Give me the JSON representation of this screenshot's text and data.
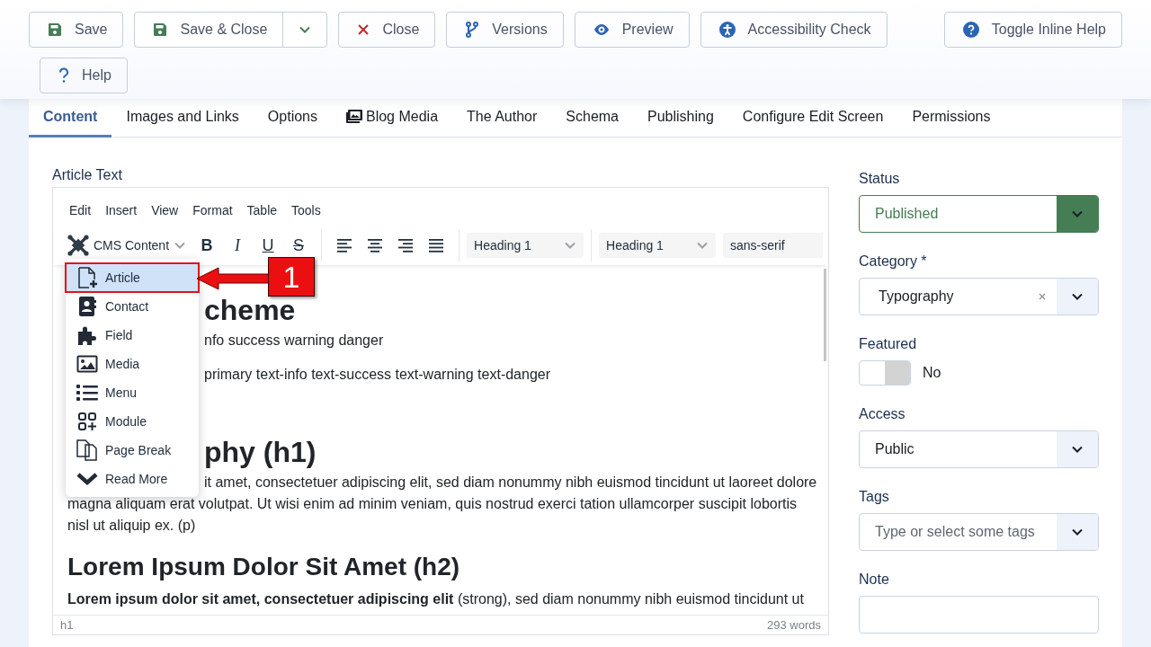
{
  "toolbar": {
    "buttons": [
      {
        "label": "Save",
        "dropdown": false
      },
      {
        "label": "Save & Close",
        "dropdown": true
      },
      {
        "label": "Close",
        "dropdown": false
      },
      {
        "label": "Versions",
        "dropdown": false
      },
      {
        "label": "Preview",
        "dropdown": false
      },
      {
        "label": "Accessibility Check",
        "dropdown": false
      }
    ],
    "right_buttons": [
      {
        "label": "Toggle Inline Help",
        "dropdown": false
      }
    ],
    "second_row": [
      {
        "label": "Help",
        "dropdown": false
      }
    ]
  },
  "tabs": [
    {
      "label": "Content",
      "selected": true
    },
    {
      "label": "Images and Links",
      "selected": false
    },
    {
      "label": "Options",
      "selected": false
    },
    {
      "label": "Blog Media",
      "selected": false
    },
    {
      "label": "The Author",
      "selected": false
    },
    {
      "label": "Schema",
      "selected": false
    },
    {
      "label": "Publishing",
      "selected": false
    },
    {
      "label": "Configure Edit Screen",
      "selected": false
    },
    {
      "label": "Permissions",
      "selected": false
    }
  ],
  "editor": {
    "label": "Article Text",
    "menubar": [
      "Edit",
      "Insert",
      "View",
      "Format",
      "Table",
      "Tools"
    ],
    "cms_content": "CMS Content",
    "format_buttons": [
      "B",
      "I",
      "U",
      "S"
    ],
    "selects": [
      "Heading 1",
      "Heading 1",
      "sans-serif"
    ],
    "dropdown": [
      {
        "label": "Article",
        "selected": true
      },
      {
        "label": "Contact",
        "selected": false
      },
      {
        "label": "Field",
        "selected": false
      },
      {
        "label": "Media",
        "selected": false
      },
      {
        "label": "Menu",
        "selected": false
      },
      {
        "label": "Module",
        "selected": false
      },
      {
        "label": "Page Break",
        "selected": false
      },
      {
        "label": "Read More",
        "selected": false
      }
    ],
    "content": [
      {
        "kind": "heading1",
        "text": "cheme"
      },
      {
        "kind": "paragraph",
        "text": "nfo success warning danger"
      },
      {
        "kind": "paragraph",
        "text": "primary text-info text-success text-warning text-danger"
      },
      {
        "kind": "heading1",
        "text": "phy (h1)"
      },
      {
        "kind": "paragraph",
        "text": "it amet, consectetuer adipiscing elit, sed diam nonummy nibh euismod tincidunt ut laoreet dolore"
      },
      {
        "kind": "continuation",
        "text": "magna aliquam erat volutpat. Ut wisi enim ad minim veniam, quis nostrud exerci tation ullamcorper suscipit lobortis nisl ut aliquip ex. (p)"
      },
      {
        "kind": "heading2",
        "text": "Lorem Ipsum Dolor Sit Amet (h2)"
      },
      {
        "kind": "paragraph",
        "text": "**Lorem ipsum dolor sit amet, consectetuer adipiscing elit** (strong), sed diam nonummy nibh euismod tincidunt ut"
      }
    ],
    "path": "h1",
    "word_count": "293 words",
    "callout": "1"
  },
  "sidebar": {
    "status": {
      "label": "Status",
      "value": "Published"
    },
    "category": {
      "label": "Category *",
      "value": "Typography"
    },
    "featured": {
      "label": "Featured",
      "on": false,
      "text": "No"
    },
    "access": {
      "label": "Access",
      "value": "Public"
    },
    "tags": {
      "label": "Tags",
      "placeholder": "Type or select some tags"
    },
    "note": {
      "label": "Note"
    }
  }
}
